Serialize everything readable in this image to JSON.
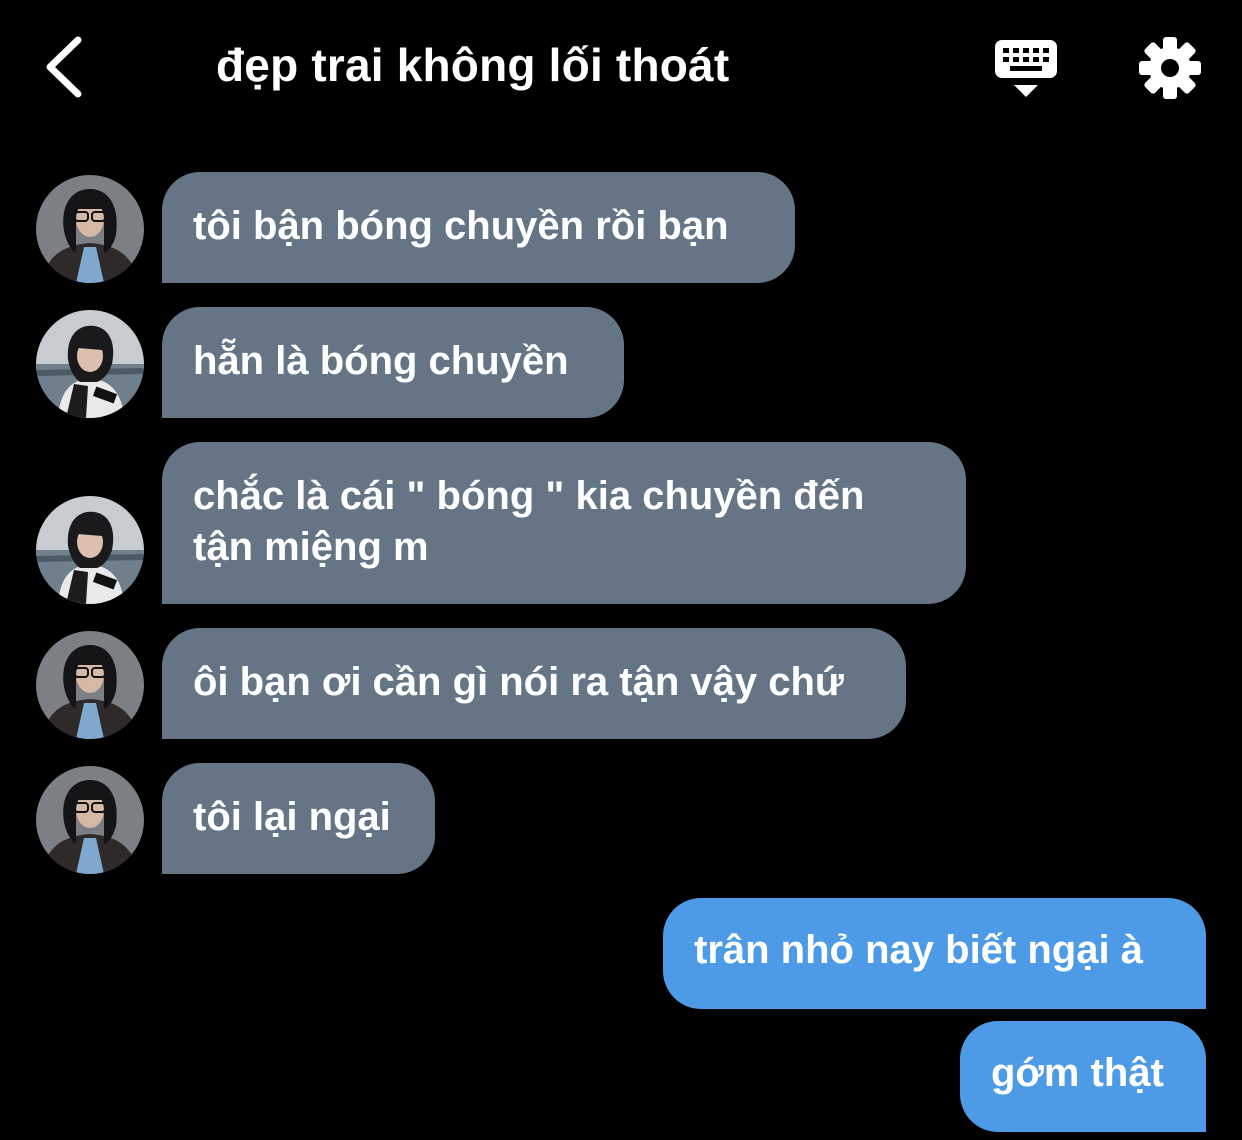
{
  "header": {
    "title": "đẹp trai không lối thoát",
    "back_icon": "chevron-left-icon",
    "keyboard_icon": "keyboard-icon",
    "settings_icon": "gear-icon"
  },
  "colors": {
    "background": "#000000",
    "incoming_bubble": "#657585",
    "outgoing_bubble": "#4d9be6",
    "text": "#ffffff"
  },
  "messages": [
    {
      "direction": "incoming",
      "avatar": "avatar-studio",
      "lines": [
        "tôi bận bóng chuyền rồi bạn"
      ]
    },
    {
      "direction": "incoming",
      "avatar": "avatar-seaside",
      "lines": [
        "hẵn là bóng chuyền"
      ]
    },
    {
      "direction": "incoming",
      "avatar": "avatar-seaside",
      "lines": [
        "chắc là cái \" bóng \" kia chuyền đến",
        "tận miệng m"
      ]
    },
    {
      "direction": "incoming",
      "avatar": "avatar-studio",
      "lines": [
        "ôi bạn ơi cần gì nói ra tận vậy chứ"
      ]
    },
    {
      "direction": "incoming",
      "avatar": "avatar-studio",
      "lines": [
        "tôi lại ngại"
      ]
    },
    {
      "direction": "outgoing",
      "lines": [
        "trân nhỏ nay biết ngại à"
      ]
    },
    {
      "direction": "outgoing",
      "lines": [
        "gớm thật"
      ]
    }
  ]
}
